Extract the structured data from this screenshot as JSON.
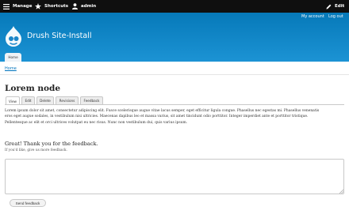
{
  "toolbar": {
    "manage": "Manage",
    "shortcuts": "Shortcuts",
    "user": "admin",
    "edit": "Edit"
  },
  "header": {
    "secondary_menu": [
      "My account",
      "Log out"
    ],
    "site_name": "Drush Site-Install",
    "main_menu": [
      "Home"
    ]
  },
  "breadcrumb": "Home",
  "page": {
    "title": "Lorem node",
    "tabs": [
      "View",
      "Edit",
      "Delete",
      "Revisions",
      "Feedback"
    ],
    "active_tab": "View",
    "body_lines": [
      "Lorem ipsum dolor sit amet, consectetur adipiscing elit. Fusce scelerisque augue vitae lacus semper, eget efficitur ligula congue. Phasellus nec egestas mi. Phasellus venenatis",
      "eros eget augue sodales, in vestibulum nisi ultricies. Maecenas dapibus leo et massa varius, sit amet tincidunt odio porttitor. Integer imperdiet ante et porttitor tristique.",
      "Pellentesque ac elit et orci ultrices volutpat eu nec risus. Nunc non vestibulum dui, quis varius ipsum."
    ]
  },
  "feedback": {
    "title": "Great! Thank you for the feedback.",
    "help": "If you'd like, give us more feedback.",
    "textarea_value": "",
    "submit_label": "Send feedback"
  },
  "colors": {
    "toolbar_bg": "#0f0f0f",
    "header_top": "#0679b9",
    "header_bottom": "#1c93d4",
    "link": "#0074bd"
  },
  "icons": [
    "hamburger-icon",
    "star-icon",
    "person-icon",
    "pencil-icon",
    "drupal-drop-logo",
    "resize-grip-icon"
  ]
}
